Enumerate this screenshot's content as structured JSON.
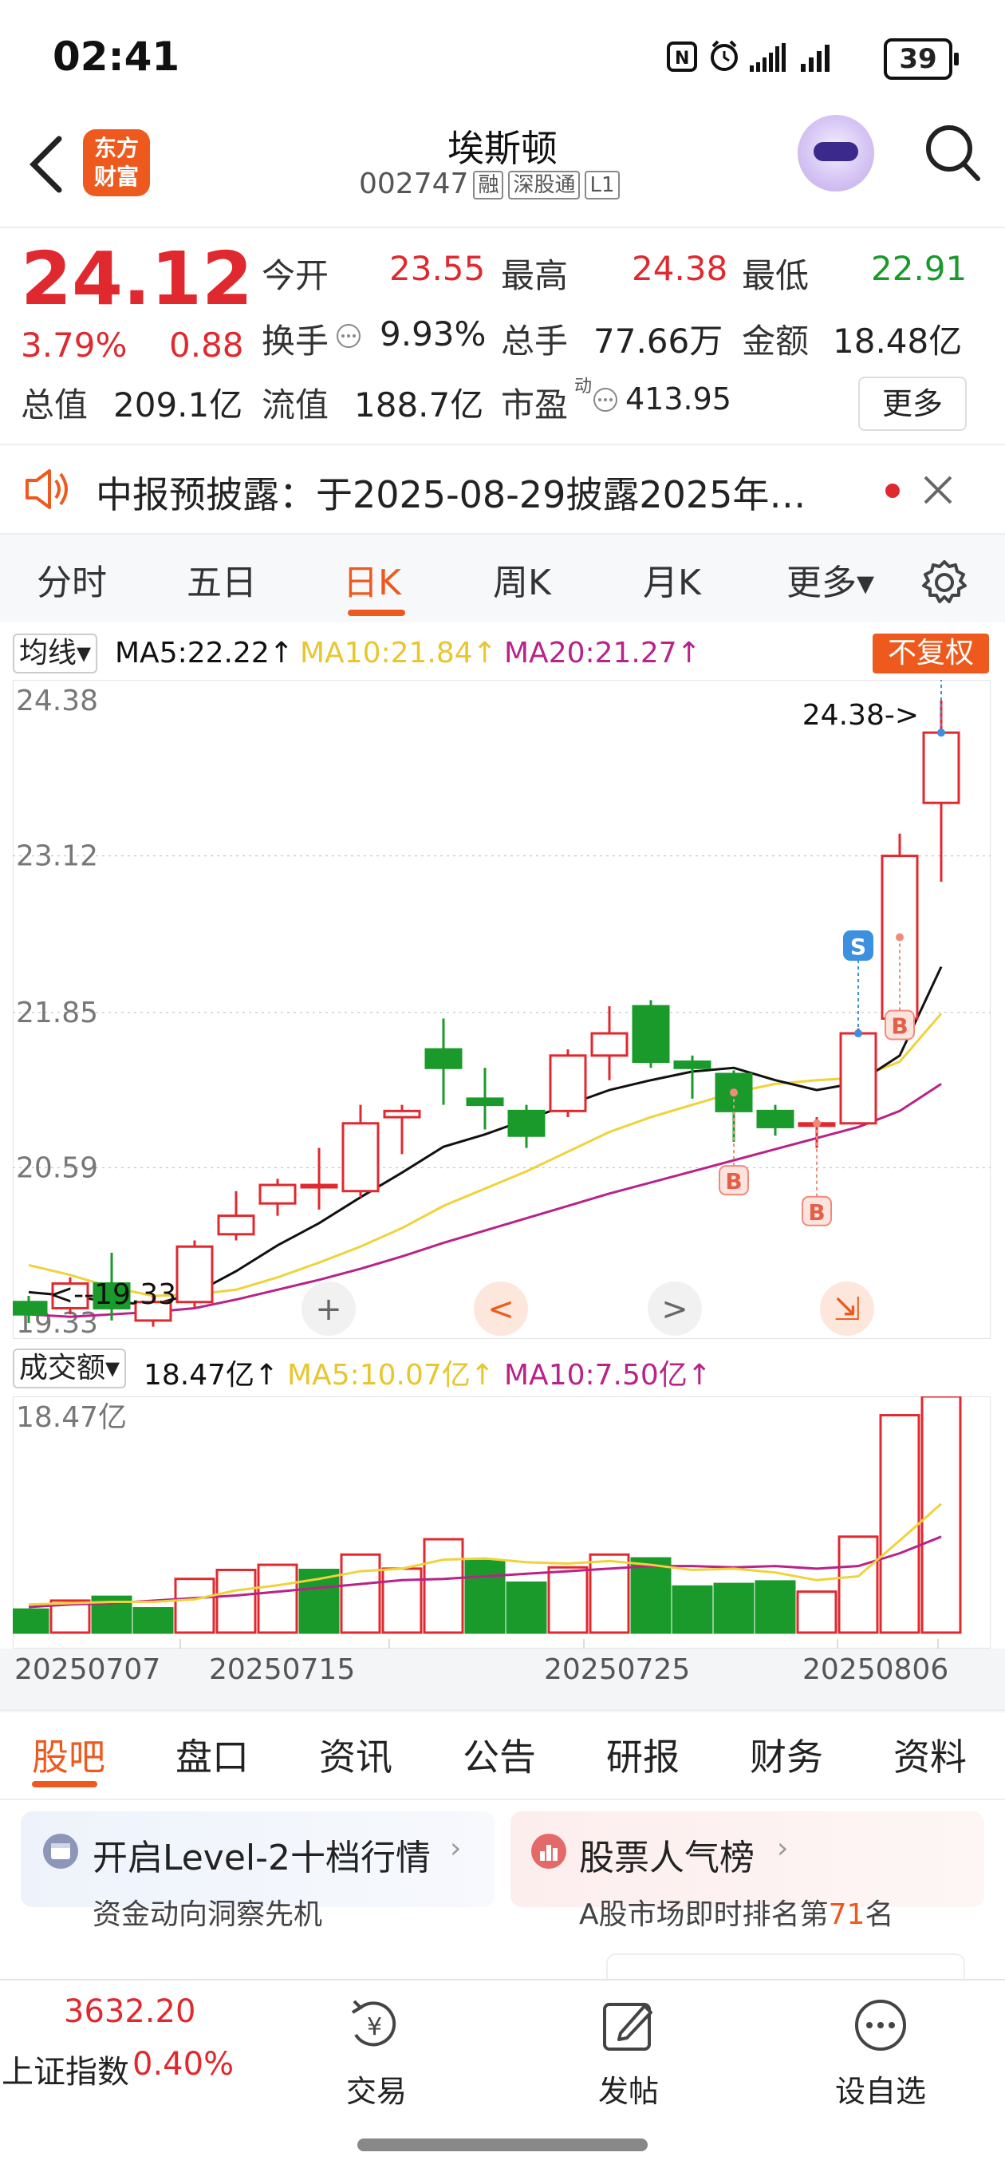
{
  "status": {
    "time": "02:41",
    "battery": "39"
  },
  "header": {
    "brand_logo": "东方\n财富",
    "title": "埃斯顿",
    "code": "002747",
    "tags": [
      "融",
      "深股通",
      "L1"
    ]
  },
  "quote": {
    "price": "24.12",
    "change_pct": "3.79%",
    "change": "0.88",
    "open_label": "今开",
    "open": "23.55",
    "high_label": "最高",
    "high": "24.38",
    "low_label": "最低",
    "low": "22.91",
    "turnover_label": "换手",
    "turnover": "9.93%",
    "volume_label": "总手",
    "volume": "77.66万",
    "amount_label": "金额",
    "amount": "18.48亿",
    "mktcap_label": "总值",
    "mktcap": "209.1亿",
    "float_label": "流值",
    "float": "188.7亿",
    "pe_label": "市盈",
    "pe_sup": "动",
    "pe": "413.95",
    "more": "更多"
  },
  "notice": {
    "text": "中报预披露：于2025-08-29披露2025年…"
  },
  "period_tabs": [
    "分时",
    "五日",
    "日K",
    "周K",
    "月K",
    "更多▾"
  ],
  "active_period": "日K",
  "ma": {
    "selector": "均线▾",
    "ma5": "MA5:22.22↑",
    "ma10": "MA10:21.84↑",
    "ma20": "MA20:21.27↑",
    "adjust_badge": "不复权"
  },
  "colors": {
    "up": "#e0292f",
    "down": "#1a9a2a",
    "ma5": "#111111",
    "ma10": "#f0d23a",
    "ma20": "#b8238a",
    "accent": "#ee5a1d",
    "marker_s": "#3d8fe0",
    "marker_b": "#f08b7b"
  },
  "chart_data": [
    {
      "type": "candlestick",
      "y_ticks": [
        "24.38",
        "23.12",
        "21.85",
        "20.59",
        "19.33"
      ],
      "ylim": [
        19.33,
        24.38
      ],
      "max_label": "24.38->",
      "min_label": "<--19.33",
      "candles": [
        {
          "o": 19.5,
          "h": 19.55,
          "l": 19.33,
          "c": 19.4
        },
        {
          "o": 19.45,
          "h": 19.7,
          "l": 19.4,
          "c": 19.65
        },
        {
          "o": 19.65,
          "h": 19.9,
          "l": 19.35,
          "c": 19.45
        },
        {
          "o": 19.35,
          "h": 19.55,
          "l": 19.3,
          "c": 19.5
        },
        {
          "o": 19.5,
          "h": 20.0,
          "l": 19.45,
          "c": 19.95
        },
        {
          "o": 20.05,
          "h": 20.4,
          "l": 20.0,
          "c": 20.2
        },
        {
          "o": 20.3,
          "h": 20.5,
          "l": 20.2,
          "c": 20.45
        },
        {
          "o": 20.45,
          "h": 20.75,
          "l": 20.25,
          "c": 20.45
        },
        {
          "o": 20.4,
          "h": 21.1,
          "l": 20.35,
          "c": 20.95
        },
        {
          "o": 21.0,
          "h": 21.1,
          "l": 20.7,
          "c": 21.05
        },
        {
          "o": 21.55,
          "h": 21.8,
          "l": 21.1,
          "c": 21.4
        },
        {
          "o": 21.15,
          "h": 21.4,
          "l": 20.9,
          "c": 21.1
        },
        {
          "o": 21.05,
          "h": 21.1,
          "l": 20.75,
          "c": 20.85
        },
        {
          "o": 21.05,
          "h": 21.55,
          "l": 21.0,
          "c": 21.5
        },
        {
          "o": 21.5,
          "h": 21.9,
          "l": 21.3,
          "c": 21.68
        },
        {
          "o": 21.9,
          "h": 21.95,
          "l": 21.4,
          "c": 21.45
        },
        {
          "o": 21.45,
          "h": 21.5,
          "l": 21.15,
          "c": 21.4
        },
        {
          "o": 21.35,
          "h": 21.38,
          "l": 20.8,
          "c": 21.05
        },
        {
          "o": 21.05,
          "h": 21.1,
          "l": 20.85,
          "c": 20.92
        },
        {
          "o": 20.95,
          "h": 21.0,
          "l": 20.75,
          "c": 20.95
        },
        {
          "o": 20.95,
          "h": 21.72,
          "l": 20.95,
          "c": 21.68
        },
        {
          "o": 21.8,
          "h": 23.3,
          "l": 21.78,
          "c": 23.12
        },
        {
          "o": 23.55,
          "h": 24.38,
          "l": 22.91,
          "c": 24.12
        }
      ],
      "ma5": [
        19.58,
        19.55,
        19.5,
        19.48,
        19.57,
        19.75,
        19.96,
        20.14,
        20.35,
        20.55,
        20.76,
        20.86,
        20.98,
        21.1,
        21.22,
        21.3,
        21.37,
        21.4,
        21.3,
        21.22,
        21.28,
        21.5,
        22.22
      ],
      "ma10": [
        19.8,
        19.72,
        19.62,
        19.55,
        19.56,
        19.6,
        19.7,
        19.82,
        19.95,
        20.1,
        20.28,
        20.42,
        20.56,
        20.72,
        20.88,
        21.0,
        21.1,
        21.2,
        21.27,
        21.3,
        21.32,
        21.45,
        21.84
      ],
      "ma20": [
        19.4,
        19.38,
        19.4,
        19.42,
        19.45,
        19.52,
        19.6,
        19.68,
        19.77,
        19.87,
        19.98,
        20.08,
        20.18,
        20.28,
        20.38,
        20.47,
        20.56,
        20.65,
        20.74,
        20.83,
        20.92,
        21.05,
        21.27
      ],
      "markers": [
        {
          "label": "S",
          "candle": 20,
          "kind": "sell"
        },
        {
          "label": "S",
          "candle": 22,
          "kind": "sell"
        },
        {
          "label": "B",
          "candle": 17,
          "kind": "buy"
        },
        {
          "label": "B",
          "candle": 19,
          "kind": "buy"
        },
        {
          "label": "B",
          "candle": 21,
          "kind": "buy"
        }
      ]
    },
    {
      "type": "bar",
      "title": "成交额▾",
      "value_label": "18.47亿↑",
      "ma5_label": "MA5:10.07亿↑",
      "ma10_label": "MA10:7.50亿↑",
      "y_max_label": "18.47亿",
      "ylim": [
        0,
        18.47
      ],
      "categories_labeled": [
        "20250707",
        "20250715",
        "20250725",
        "20250806"
      ],
      "values": [
        1.8,
        2.5,
        2.8,
        1.9,
        4.2,
        4.9,
        5.3,
        4.9,
        6.1,
        5.0,
        7.3,
        5.6,
        3.9,
        5.1,
        6.1,
        5.8,
        3.6,
        3.8,
        4.0,
        3.2,
        7.5,
        17.0,
        18.47
      ],
      "up": [
        false,
        true,
        false,
        false,
        true,
        true,
        true,
        false,
        true,
        true,
        true,
        false,
        false,
        true,
        true,
        false,
        false,
        false,
        false,
        true,
        true,
        true,
        true
      ],
      "ma5": [
        2.2,
        2.3,
        2.4,
        2.4,
        2.6,
        3.3,
        3.7,
        4.2,
        4.8,
        5.0,
        5.7,
        5.8,
        5.5,
        5.4,
        5.6,
        5.3,
        4.9,
        5.0,
        4.7,
        4.1,
        4.4,
        7.2,
        10.07
      ],
      "ma10": [
        2.0,
        2.2,
        2.3,
        2.5,
        2.7,
        2.9,
        3.2,
        3.5,
        3.8,
        4.1,
        4.2,
        4.4,
        4.6,
        4.8,
        5.0,
        5.2,
        5.2,
        5.1,
        5.2,
        5.0,
        5.2,
        6.2,
        7.5
      ]
    }
  ],
  "chart_controls": [
    "+",
    "<",
    ">",
    "⇲"
  ],
  "bottom_tabs": [
    "股吧",
    "盘口",
    "资讯",
    "公告",
    "研报",
    "财务",
    "资料"
  ],
  "active_bottom_tab": "股吧",
  "cards": [
    {
      "title": "开启Level-2十档行情",
      "sub": "资金动向洞察先机"
    },
    {
      "title": "股票人气榜",
      "sub_pre": "A股市场即时排名第",
      "sub_num": "71",
      "sub_post": "名"
    }
  ],
  "footer": {
    "index_value": "3632.20",
    "index_name": "上证指数",
    "index_change": "0.40%",
    "nav": [
      "交易",
      "发帖",
      "设自选"
    ]
  }
}
